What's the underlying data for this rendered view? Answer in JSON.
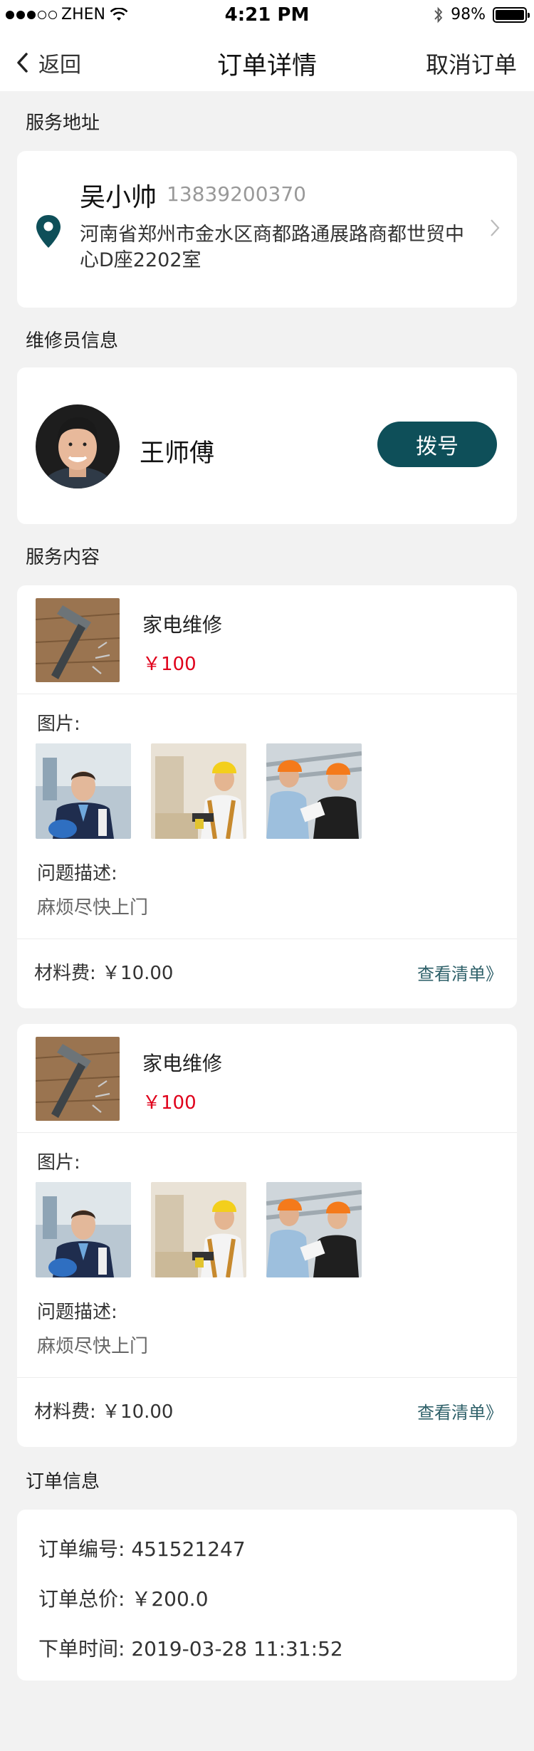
{
  "status_bar": {
    "carrier": "ZHEN",
    "time": "4:21 PM",
    "battery": "98%"
  },
  "nav": {
    "back_label": "返回",
    "title": "订单详情",
    "cancel_label": "取消订单"
  },
  "address_section": {
    "title": "服务地址",
    "name": "吴小帅",
    "phone": "13839200370",
    "address": "河南省郑州市金水区商都路通展路商都世贸中心D座2202室"
  },
  "repairman_section": {
    "title": "维修员信息",
    "name": "王师傅",
    "dial_label": "拨号"
  },
  "service_section": {
    "title": "服务内容",
    "items": [
      {
        "name": "家电维修",
        "price": "￥100",
        "photos_label": "图片:",
        "desc_label": "问题描述:",
        "desc": "麻烦尽快上门",
        "material_label": "材料费:",
        "material_fee": "￥10.00",
        "view_list": "查看清单》"
      },
      {
        "name": "家电维修",
        "price": "￥100",
        "photos_label": "图片:",
        "desc_label": "问题描述:",
        "desc": "麻烦尽快上门",
        "material_label": "材料费:",
        "material_fee": "￥10.00",
        "view_list": "查看清单》"
      }
    ]
  },
  "order_section": {
    "title": "订单信息",
    "number_label": "订单编号:",
    "number": "451521247",
    "total_label": "订单总价:",
    "total": "￥200.0",
    "time_label": "下单时间:",
    "time": "2019-03-28 11:31:52"
  },
  "colors": {
    "accent": "#0e4f59",
    "price": "#e0001b",
    "link": "#2e6069"
  }
}
